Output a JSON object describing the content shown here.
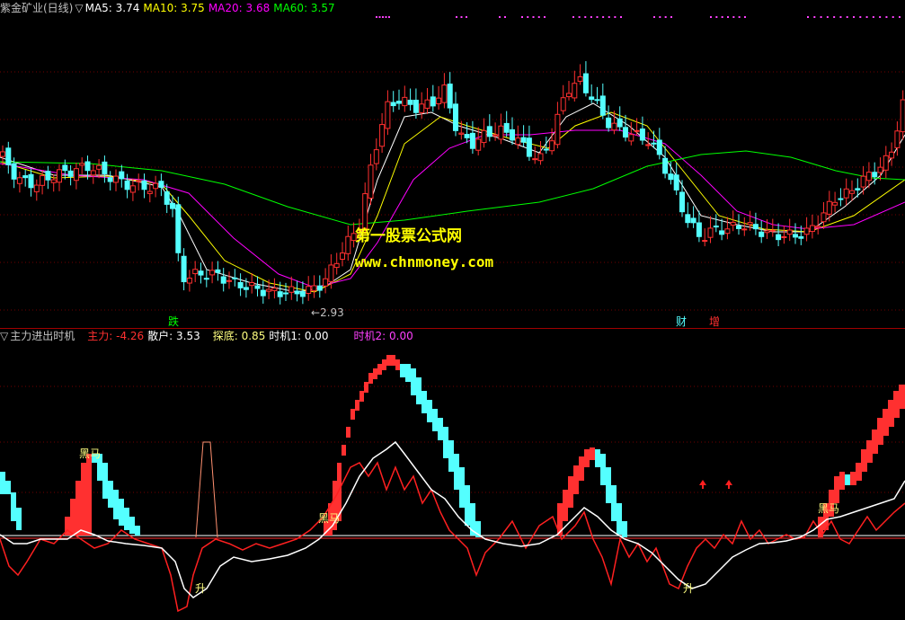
{
  "top_header": {
    "stock_name": "紫金矿业(日线)",
    "indicator_marker": "▽",
    "ma5": {
      "label": "MA5: 3.74",
      "color": "#ffffff"
    },
    "ma10": {
      "label": "MA10: 3.75",
      "color": "#ffff00"
    },
    "ma20": {
      "label": "MA20: 3.68",
      "color": "#ff00ff"
    },
    "ma60": {
      "label": "MA60: 3.57",
      "color": "#00ff00"
    }
  },
  "bottom_header": {
    "indicator_marker": "▽",
    "indicator_name": "主力进出时机",
    "zhuli": {
      "label": "主力: -4.26",
      "color": "#ff3030"
    },
    "sanhu": {
      "label": "散户: 3.53",
      "color": "#ffffff"
    },
    "tandi": {
      "label": "探底: 0.85",
      "color": "#ffff80"
    },
    "shiji1": {
      "label": "时机1: 0.00",
      "color": "#ffffff"
    },
    "shiji2": {
      "label": "时机2: 0.00",
      "color": "#ff40ff"
    }
  },
  "watermark": {
    "site_name": "第一股票公式网",
    "url": "www.chnmoney.com"
  },
  "price_annotations": {
    "low_price": "2.93",
    "signal_die": "跌",
    "signal_cai": "财",
    "signal_zeng": "增"
  },
  "indicator_annotations": {
    "heima": "黑马",
    "sheng": "升"
  },
  "colors": {
    "up_candle": "#ff3030",
    "down_candle": "#54ffff",
    "zhuli_line": "#ff2020",
    "sanhu_line": "#ffffff",
    "separator": "#a00000",
    "watermark": "#ffff00"
  }
}
